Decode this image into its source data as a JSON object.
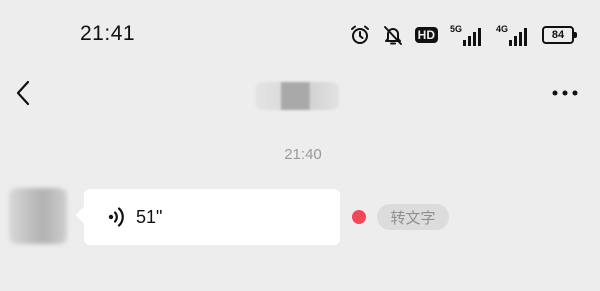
{
  "status_bar": {
    "time": "21:41",
    "icons": [
      "alarm-icon",
      "notifications-muted-icon",
      "hd-voice-icon",
      "5g-signal-icon",
      "4g-signal-icon",
      "battery-icon"
    ],
    "hd_label": "HD",
    "signal_1_label": "5G",
    "signal_2_label": "4G",
    "battery_level": "84"
  },
  "nav": {
    "back_icon": "chevron-left-icon",
    "more_icon": "more-dots-icon"
  },
  "chat": {
    "timestamp": "21:40",
    "message": {
      "type": "voice",
      "duration": "51\"",
      "unread": true,
      "unread_color": "#f2485a"
    },
    "transcribe_label": "转文字"
  },
  "colors": {
    "background": "#ededed",
    "bubble": "#ffffff",
    "muted_text": "#9a9a9a"
  }
}
